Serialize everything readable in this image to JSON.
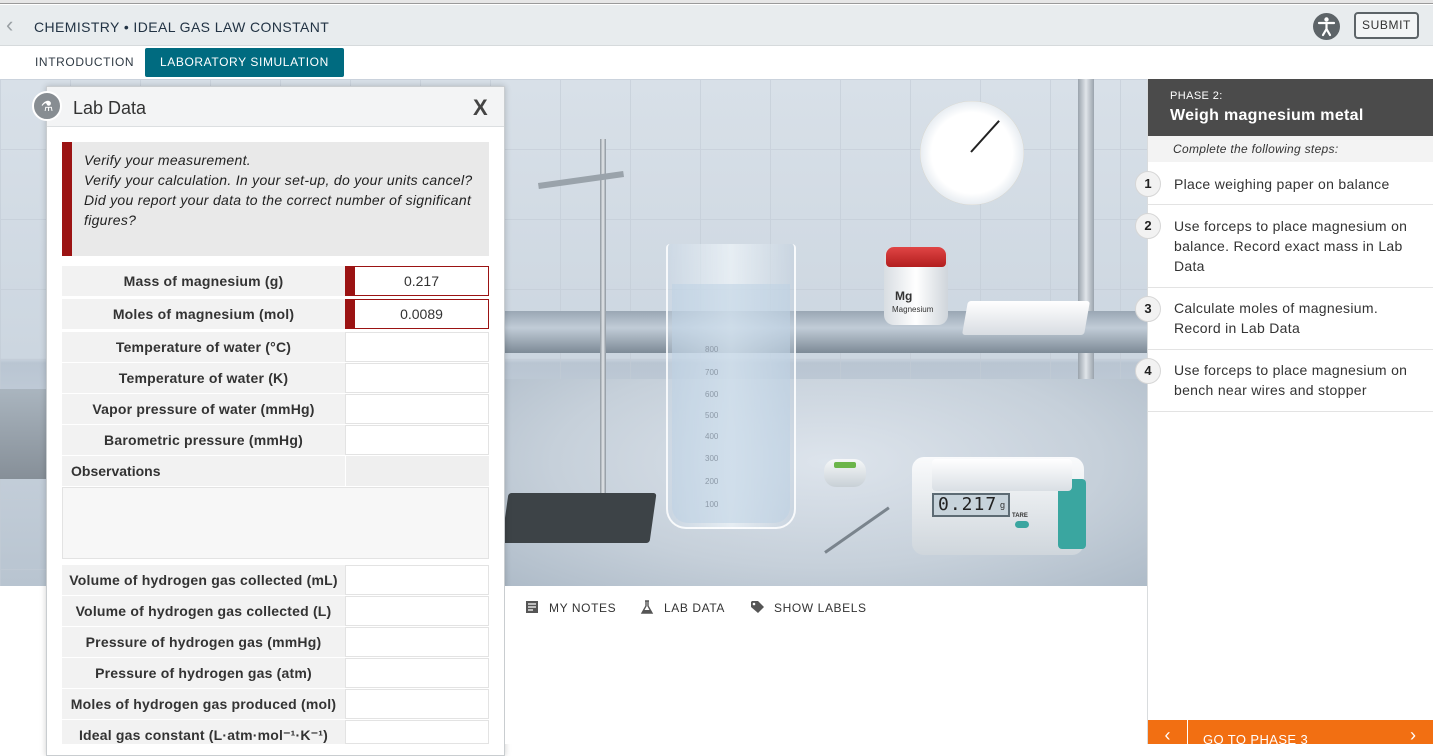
{
  "header": {
    "breadcrumb": "CHEMISTRY • IDEAL GAS LAW CONSTANT",
    "submit_label": "SUBMIT"
  },
  "tabs": [
    {
      "label": "INTRODUCTION",
      "active": false
    },
    {
      "label": "LABORATORY SIMULATION",
      "active": true
    }
  ],
  "lab_data": {
    "title": "Lab Data",
    "close_label": "X",
    "feedback": [
      "Verify your measurement.",
      "Verify your calculation. In your set-up, do your units cancel?",
      "Did you report your data to the correct number of significant figures?"
    ],
    "rows_top": [
      {
        "label": "Mass of magnesium (g)",
        "value": "0.217",
        "error": true
      },
      {
        "label": "Moles of magnesium (mol)",
        "value": "0.0089",
        "error": true
      },
      {
        "label": "Temperature of water (°C)",
        "value": ""
      },
      {
        "label": "Temperature of water (K)",
        "value": ""
      },
      {
        "label": "Vapor pressure of water (mmHg)",
        "value": ""
      },
      {
        "label": "Barometric pressure (mmHg)",
        "value": ""
      }
    ],
    "observations_label": "Observations",
    "rows_bottom": [
      {
        "label": "Volume of hydrogen gas collected (mL)",
        "value": ""
      },
      {
        "label": "Volume of hydrogen gas collected (L)",
        "value": ""
      },
      {
        "label": "Pressure of hydrogen gas (mmHg)",
        "value": ""
      },
      {
        "label": "Pressure of hydrogen gas (atm)",
        "value": ""
      },
      {
        "label": "Moles of hydrogen gas produced (mol)",
        "value": ""
      },
      {
        "label": "Ideal gas constant (L·atm·mol⁻¹·K⁻¹)",
        "value": ""
      }
    ]
  },
  "scene": {
    "balance_reading": "0.217",
    "balance_unit": "g",
    "balance_tare": "TARE",
    "jar_symbol": "Mg",
    "jar_name": "Magnesium",
    "beaker_marks": [
      "800",
      "700",
      "600",
      "500",
      "400",
      "300",
      "200",
      "100"
    ]
  },
  "toolbar": {
    "my_notes": "MY NOTES",
    "lab_data": "LAB DATA",
    "show_labels": "SHOW LABELS"
  },
  "phase": {
    "number_label": "PHASE 2:",
    "title": "Weigh magnesium metal",
    "hint": "Complete the following steps:",
    "steps": [
      {
        "num": "1",
        "text": "Place weighing paper on balance"
      },
      {
        "num": "2",
        "text": "Use forceps to place magnesium on balance. Record exact mass in Lab Data"
      },
      {
        "num": "3",
        "text": "Calculate moles of magnesium. Record in Lab Data"
      },
      {
        "num": "4",
        "text": "Use forceps to place magnesium on bench near wires and stopper"
      }
    ],
    "next_label": "GO TO PHASE 3"
  },
  "colors": {
    "accent_tab": "#006b80",
    "error": "#9b1313",
    "phase_header": "#4b4b4b",
    "next_bar": "#f26f12"
  }
}
